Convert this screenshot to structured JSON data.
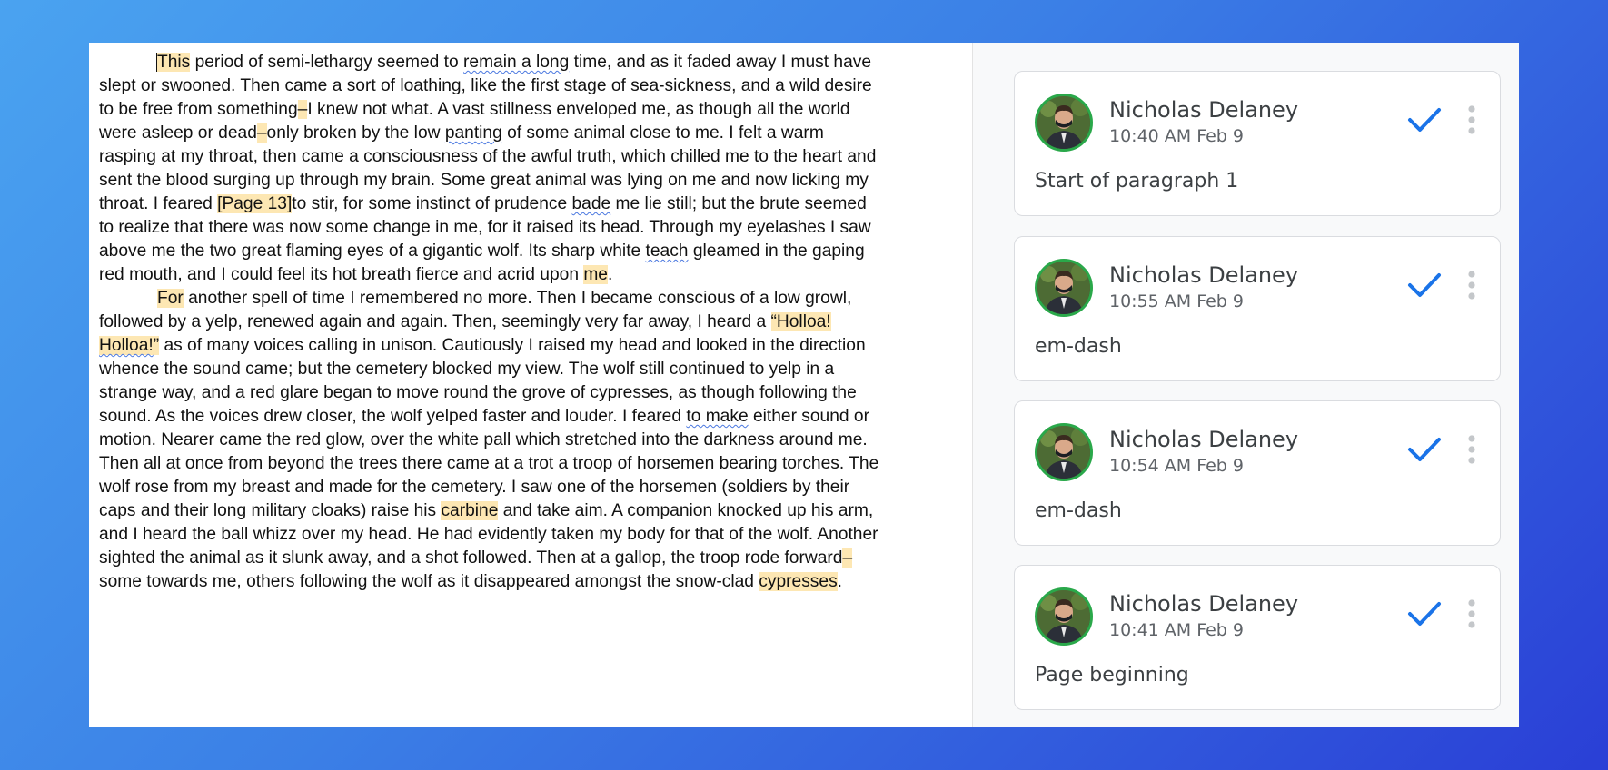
{
  "document": {
    "paragraphs": [
      [
        {
          "t": "This",
          "hl": true,
          "cursor": true
        },
        {
          "t": " period of semi-lethargy seemed to "
        },
        {
          "t": "remain a long",
          "sq": true
        },
        {
          "t": " time, and as it faded away I must have slept or swooned. Then came a sort of loathing, like the first stage of sea-sickness, and a wild desire to be free from something"
        },
        {
          "t": "–",
          "hl": true
        },
        {
          "t": "I knew not what. A vast stillness enveloped me, as though all the world were asleep or dead"
        },
        {
          "t": "–",
          "hl": true
        },
        {
          "t": "only broken by the low "
        },
        {
          "t": "panting",
          "sq": true
        },
        {
          "t": " of some animal close to me. I felt a warm rasping at my throat, then came a consciousness of the awful truth, which chilled me to the heart and sent the blood surging up through my brain. Some great animal was lying on me and now licking my throat. I feared "
        },
        {
          "t": "[Page 13]",
          "hl": true
        },
        {
          "t": "to stir, for some instinct of prudence "
        },
        {
          "t": "bade",
          "sq": true
        },
        {
          "t": " me lie still; but the brute seemed to realize that there was now some change in me, for it raised its head. Through my eyelashes I saw above me the two great flaming eyes of a gigantic wolf. Its sharp white "
        },
        {
          "t": "teach",
          "sq": true
        },
        {
          "t": " gleamed in the gaping red mouth, and I could feel its hot breath fierce and acrid upon "
        },
        {
          "t": "me",
          "hl": true
        },
        {
          "t": "."
        }
      ],
      [
        {
          "t": "For",
          "hl": true
        },
        {
          "t": " another spell of time I remembered no more. Then I became conscious of a low growl, followed by a yelp, renewed again and again. Then, seemingly very far away, I heard a "
        },
        {
          "t": "“Holloa! ",
          "hl": true
        },
        {
          "t": "Holloa!",
          "hl": true,
          "sq": true
        },
        {
          "t": "”",
          "hl": true
        },
        {
          "t": " as of many voices calling in unison. Cautiously I raised my head and looked in the direction whence the sound came; but the cemetery blocked my view. The wolf still continued to yelp in a strange way, and a red glare began to move round the grove of cypresses, as though following the sound. As the voices drew closer, the wolf yelped faster and louder. I feared "
        },
        {
          "t": "to make",
          "sq": true
        },
        {
          "t": " either sound or motion. Nearer came the red glow, over the white pall which stretched into the darkness around me. Then all at once from beyond the trees there came at a trot a troop of horsemen bearing torches. The wolf rose from my breast and made for the cemetery. I saw one of the horsemen (soldiers by their caps and their long military cloaks) raise his "
        },
        {
          "t": "carbine",
          "hl": true
        },
        {
          "t": " and take aim. A companion knocked up his arm, and I heard the ball whizz over my head. He had evidently taken my body for that of the wolf. Another sighted the animal as it slunk away, and a shot followed. Then at a gallop, the troop rode forward"
        },
        {
          "t": "–",
          "hl": true
        },
        {
          "t": "some towards me, others following the wolf as it disappeared amongst the snow-clad "
        },
        {
          "t": "cypresses",
          "hl": true
        },
        {
          "t": "."
        }
      ]
    ]
  },
  "comments": [
    {
      "author": "Nicholas Delaney",
      "time": "10:40 AM Feb 9",
      "text": "Start of paragraph 1"
    },
    {
      "author": "Nicholas Delaney",
      "time": "10:55 AM Feb 9",
      "text": "em-dash"
    },
    {
      "author": "Nicholas Delaney",
      "time": "10:54 AM Feb 9",
      "text": "em-dash"
    },
    {
      "author": "Nicholas Delaney",
      "time": "10:41 AM Feb 9",
      "text": "Page beginning"
    }
  ],
  "icons": {
    "resolve": "check-icon",
    "more": "more-vert-icon",
    "avatar": "user-avatar"
  },
  "colors": {
    "highlight": "#fde7b3",
    "check": "#1a73e8",
    "avatar_ring": "#2aa84a",
    "spellcheck": "#4a78e0"
  }
}
